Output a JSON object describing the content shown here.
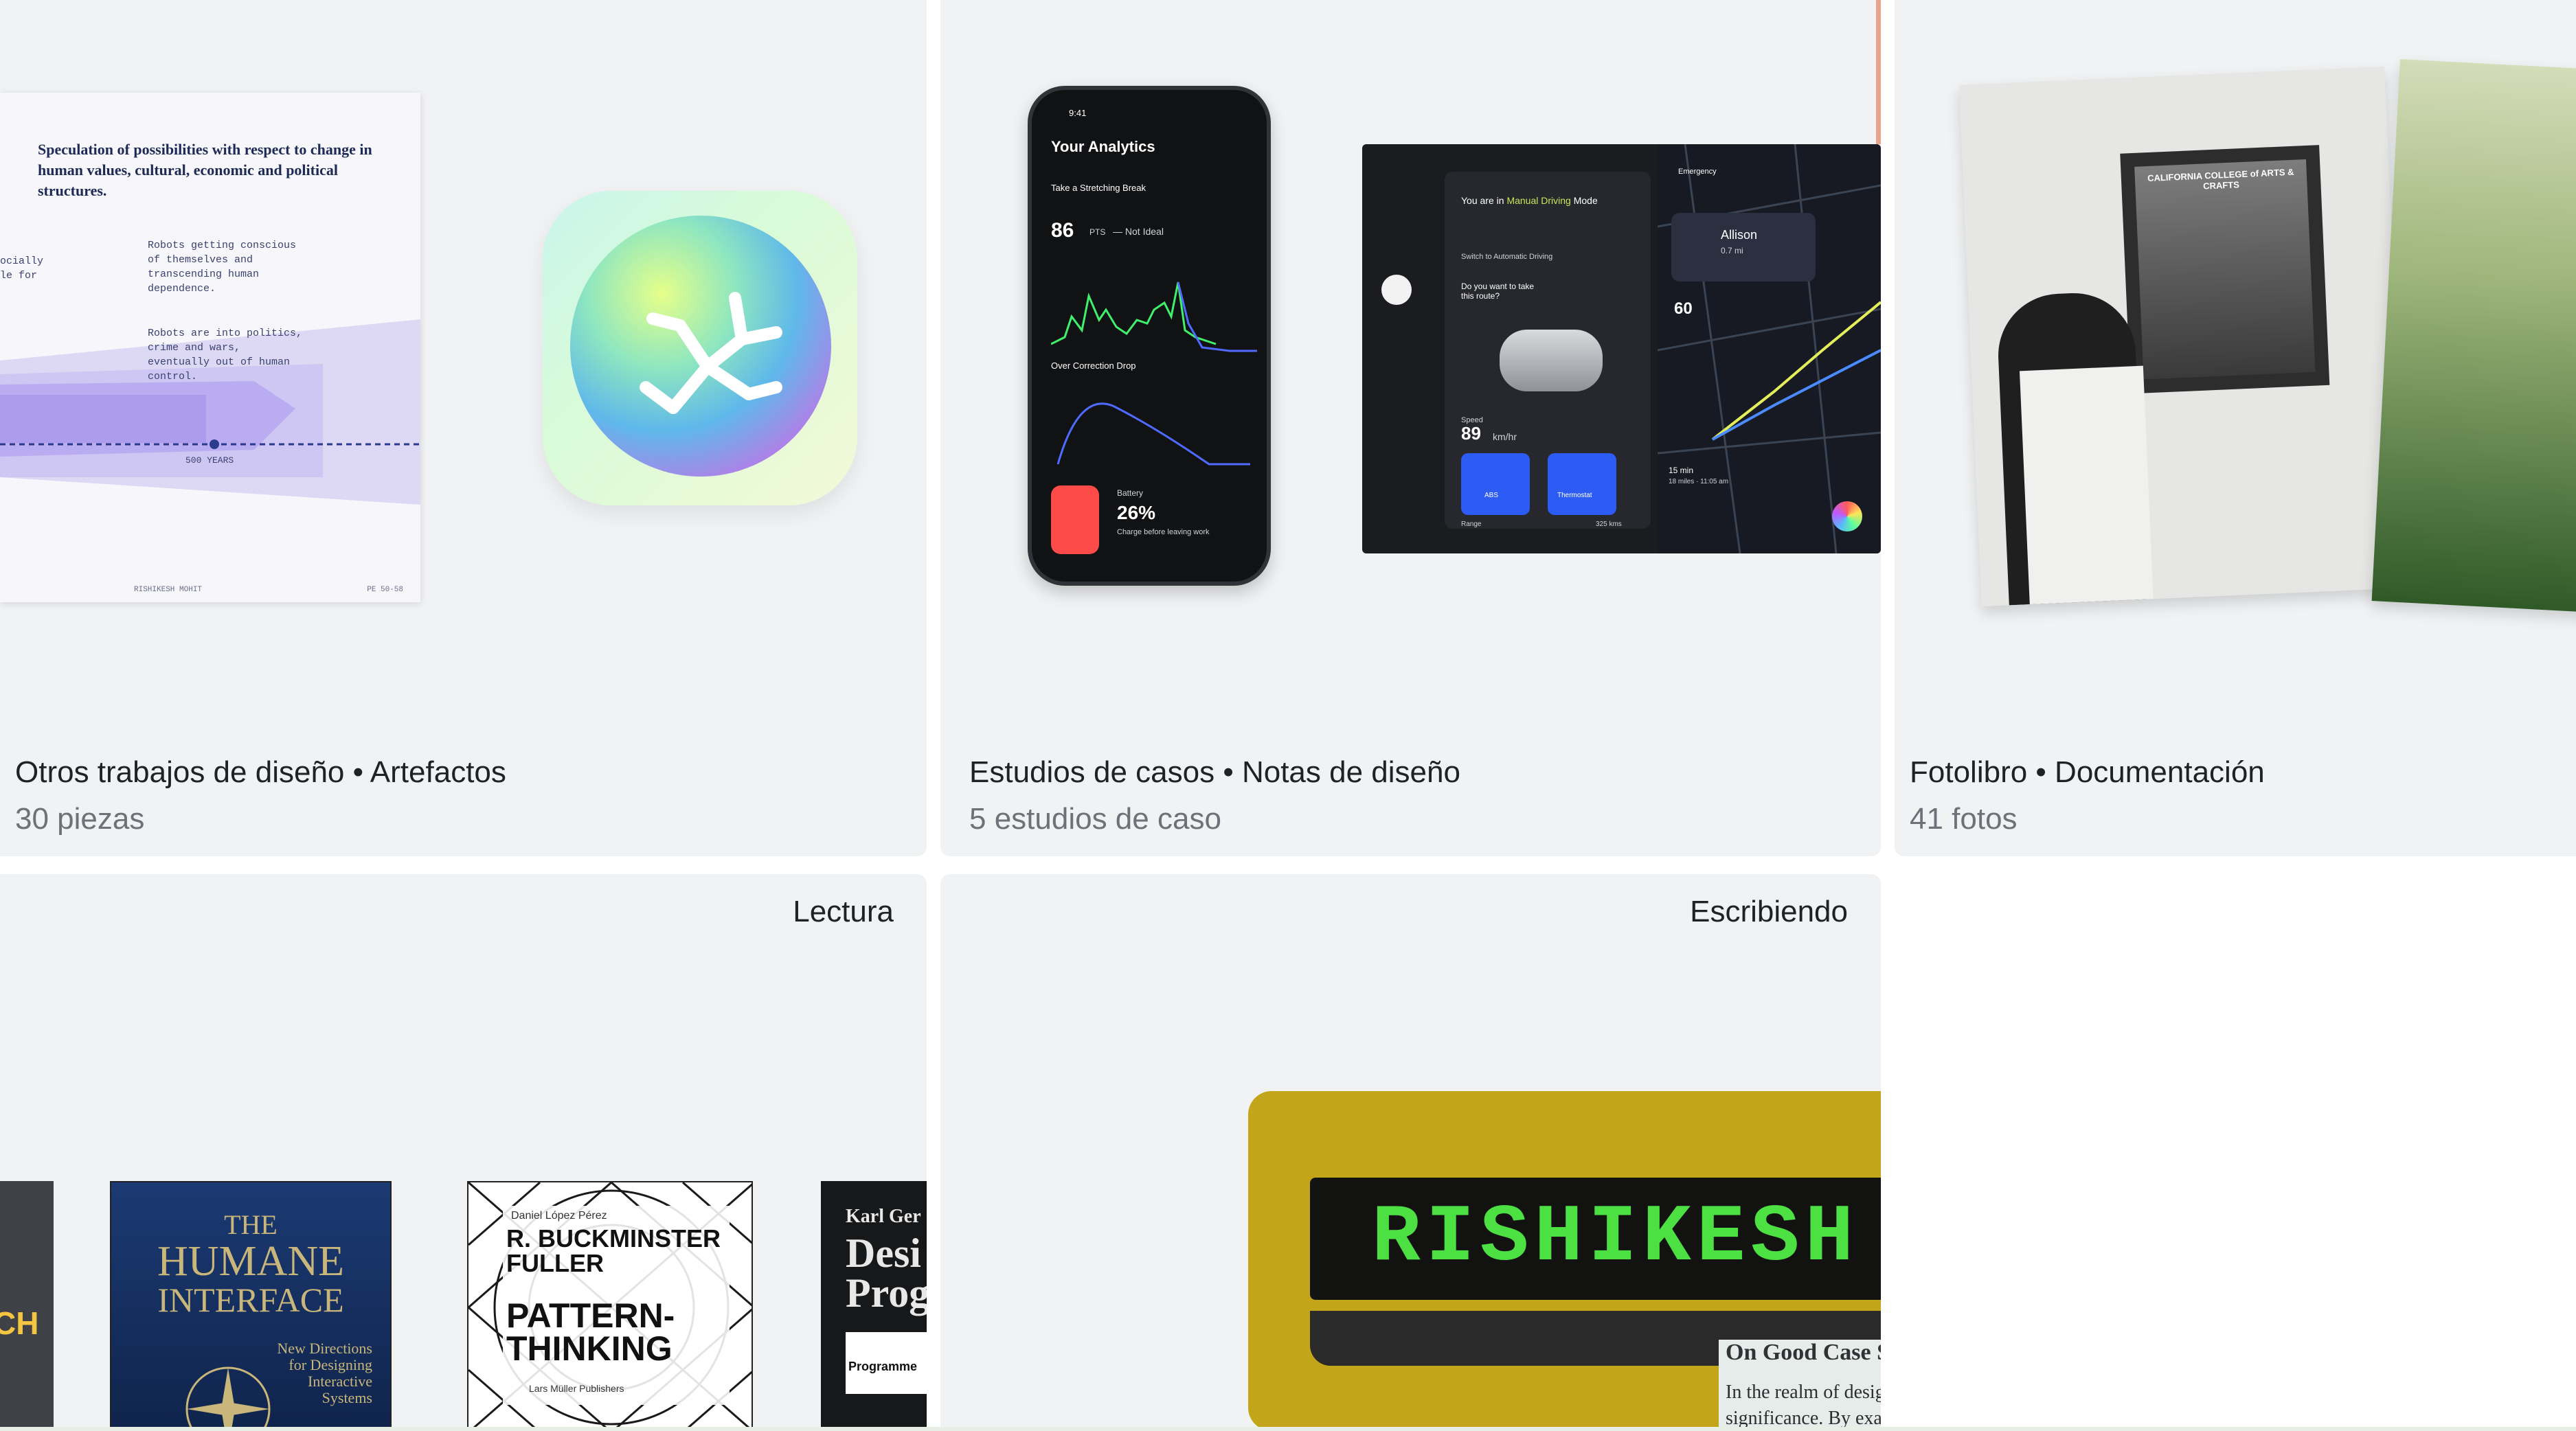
{
  "cards": [
    {
      "title": "Otros trabajos de diseño • Artefactos",
      "count": "30 piezas",
      "poster": {
        "heading": "Speculation of possibilities with respect to change in human values, cultural, economic and political structures.",
        "note1": "Robots getting conscious of themselves and transcending human dependence.",
        "note2": "Robots are into politics, crime and wars, eventually out of human control.",
        "left_frag": "ocially le for",
        "years": "500 YEARS",
        "foot_left": "RISHIKESH MOHIT",
        "foot_right": "PE 50-58"
      }
    },
    {
      "title": "Estudios de casos • Notas de diseño",
      "count": "5 estudios de caso",
      "phone": {
        "time": "9:41",
        "title": "Your Analytics",
        "exercise": "Take a Stretching Break",
        "score": "86",
        "score_unit": "PTS",
        "score_note": "— Not Ideal",
        "chart_title": "Over Correction Drop",
        "battery_label": "Battery",
        "battery": "26%",
        "battery_note": "Charge before leaving work"
      },
      "dashboard": {
        "mode_prefix": "You are in",
        "mode": "Manual Driving",
        "mode_suffix": "Mode",
        "switch": "Switch to Automatic Driving",
        "question": "Do you want to take this route?",
        "speed_label": "Speed",
        "speed": "89",
        "speed_unit": "km/hr",
        "tile1": "ABS",
        "tile2": "Thermostat",
        "range_label": "Range",
        "range": "325 kms",
        "emergency": "Emergency",
        "contact": "Allison",
        "distance": "0.7 mi",
        "limit": "60",
        "eta": "15 min",
        "eta_detail": "18 miles · 11:05 am"
      }
    },
    {
      "title": "Fotolibro • Documentación",
      "count": "41 fotos",
      "sign": "CALIFORNIA COLLEGE of ARTS & CRAFTS"
    },
    {
      "label": "Lectura",
      "books": [
        {
          "title": "CH"
        },
        {
          "title_the": "THE",
          "title_main": "HUMANE",
          "title_sub": "INTERFACE",
          "subtitle": "New Directions for Designing Interactive Systems"
        },
        {
          "author_top": "Daniel López Pérez",
          "author": "R. BUCKMINSTER FULLER",
          "title": "PATTERN-THINKING",
          "publisher": "Lars Müller Publishers"
        },
        {
          "author": "Karl Ger",
          "title": "Desi Prog",
          "sub": "Programme"
        }
      ]
    },
    {
      "label": "Escribiendo",
      "lcd": "RISHIKESH",
      "paper_heading": "On Good Case Studies",
      "paper_body": "In the realm of design, the art of st significance. By examining and dis"
    }
  ]
}
